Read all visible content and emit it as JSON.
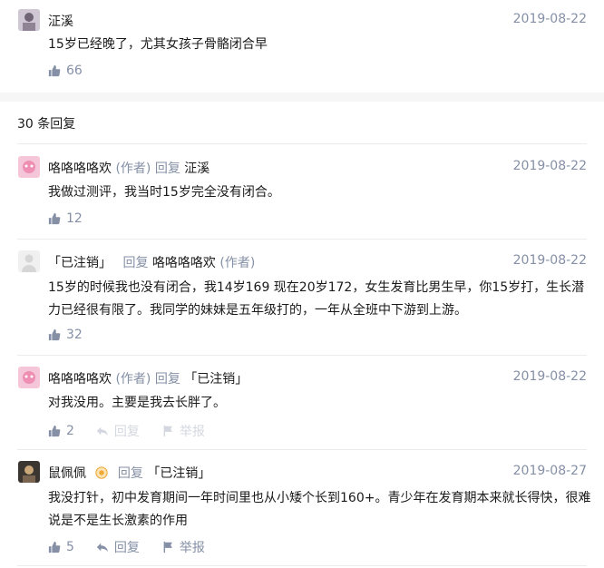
{
  "top": {
    "name": "泟溪",
    "date": "2019-08-22",
    "content": "15岁已经晚了，尤其女孩子骨骼闭合早",
    "likes": "66"
  },
  "reply_count": "30 条回复",
  "replies": [
    {
      "name": "咯咯咯咯欢",
      "author_tag": "(作者)",
      "reply_word": "回复",
      "target": "泟溪",
      "date": "2019-08-22",
      "content": "我做过测评，我当时15岁完全没有闭合。",
      "likes": "12"
    },
    {
      "name": "「已注销」",
      "reply_word": "回复",
      "target": "咯咯咯咯欢",
      "target_tag": "(作者)",
      "date": "2019-08-22",
      "content": "15岁的时候我也没有闭合，我14岁169 现在20岁172，女生发育比男生早，你15岁打，生长潜力已经很有限了。我同学的妹妹是五年级打的，一年从全班中下游到上游。",
      "likes": "32"
    },
    {
      "name": "咯咯咯咯欢",
      "author_tag": "(作者)",
      "reply_word": "回复",
      "target": "「已注销」",
      "date": "2019-08-22",
      "content": "对我没用。主要是我去长胖了。",
      "likes": "2",
      "reply_label": "回复",
      "report_label": "举报"
    },
    {
      "name": "鼠佩佩",
      "reply_word": "回复",
      "target": "「已注销」",
      "date": "2019-08-27",
      "content": "我没打针，初中发育期间一年时间里也从小矮个长到160+。青少年在发育期本来就长得快，很难说是不是生长激素的作用",
      "likes": "5",
      "reply_label": "回复",
      "report_label": "举报"
    }
  ],
  "icons": {
    "like": "thumbs-up-icon",
    "reply": "reply-arrow-icon",
    "report": "flag-icon",
    "verified": "verified-badge-icon"
  },
  "colors": {
    "meta": "#8590a6",
    "text": "#1a1a1a",
    "band": "#f6f6f6"
  }
}
